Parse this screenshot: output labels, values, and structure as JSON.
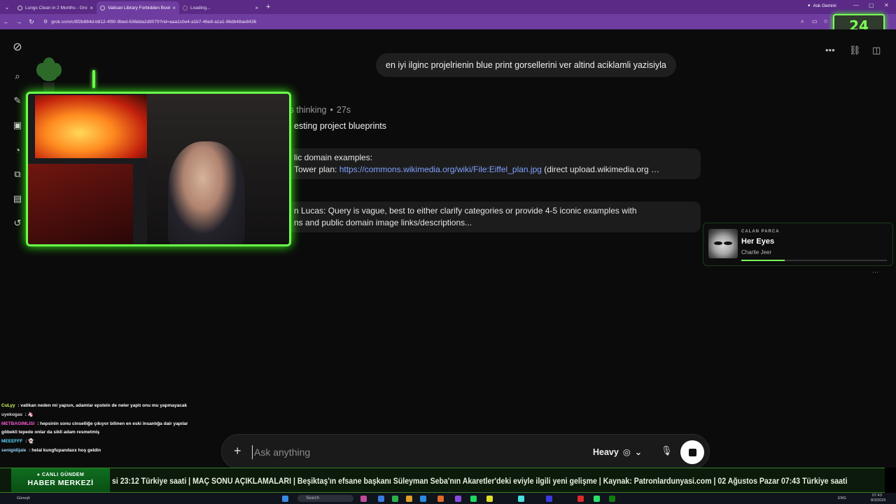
{
  "browser": {
    "tabs": [
      {
        "title": "Lungs Clean in 2 Months - Grok",
        "active": false
      },
      {
        "title": "Vatican Library Forbidden Books",
        "active": true
      },
      {
        "title": "Loading...",
        "active": false
      }
    ],
    "new_tab": "+",
    "ask_gemini": "Ask Gemini",
    "url": "grok.com/c/8f2b884d-b812-4f90-9bed-636dda2d9079?rid=aaa1c0e4-a1b7-46e8-a1a1-96db48ae8436"
  },
  "overlay_counter": "24",
  "conversation": {
    "user_message": "en iyi ilginc projelrienin blue print gorsellerini ver altind aciklamli yazisiyla",
    "thinking_label": "Agents thinking",
    "thinking_time": "27s",
    "line1": "esting project blueprints",
    "card1": {
      "line_a": "lic domain examples:",
      "line_b_prefix": "Tower plan: ",
      "link": "https://commons.wikimedia.org/wiki/File:Eiffel_plan.jpg",
      "line_b_suffix": " (direct upload.wikimedia.org …"
    },
    "card2": {
      "line_a": "n Lucas: Query is vague, best to either clarify categories or provide 4-5 iconic examples with",
      "line_b": "ns and public domain image links/descriptions..."
    }
  },
  "now_playing": {
    "label": "CALAN PARCA",
    "title": "Her Eyes",
    "artist": "Charlie Jeer",
    "progress": 0.3
  },
  "chat": [
    {
      "user": "CuLyy",
      "color": "#d8ff5a",
      "text": "vatikan neden mi yapsın, adamlar epstein de neler yaptı onu mu yapmayacak"
    },
    {
      "user": "uyekogas",
      "color": "#dcdcdc",
      "text": "🦄"
    },
    {
      "user": "METBAGIMLISI",
      "color": "#ff5ad8",
      "text": "hepsinin sonu cinselliğe çıkıyor bilinen en eski insanlığa dair yapılar göbekli tepede onlar da sikli adam resmetmiş"
    },
    {
      "user": "MEEEFFF",
      "color": "#5ad8ff",
      "text": "👻"
    },
    {
      "user": "senigidijale",
      "color": "#9ad8ff",
      "text": "helal kungfupandaxx hoş geldin"
    }
  ],
  "composer": {
    "placeholder": "Ask anything",
    "mode": "Heavy"
  },
  "ticker": {
    "label_top": "● CANLI GÜNDEM",
    "label_bottom": "HABER MERKEZİ",
    "text": "si 23:12 Türkiye saati | MAÇ SONU AÇIKLAMALARI | Beşiktaş'ın efsane başkanı Süleyman Seba'nın Akaretler'deki eviyle ilgili yeni gelişme | Kaynak: Patronlardunyasi.com | 02 Ağustos Pazar 07:43 Türkiye saati"
  },
  "taskbar": {
    "search": "Search",
    "lang": "ENG",
    "time": "07:43",
    "date": "8/3/2026",
    "weather": "Güneşli"
  }
}
